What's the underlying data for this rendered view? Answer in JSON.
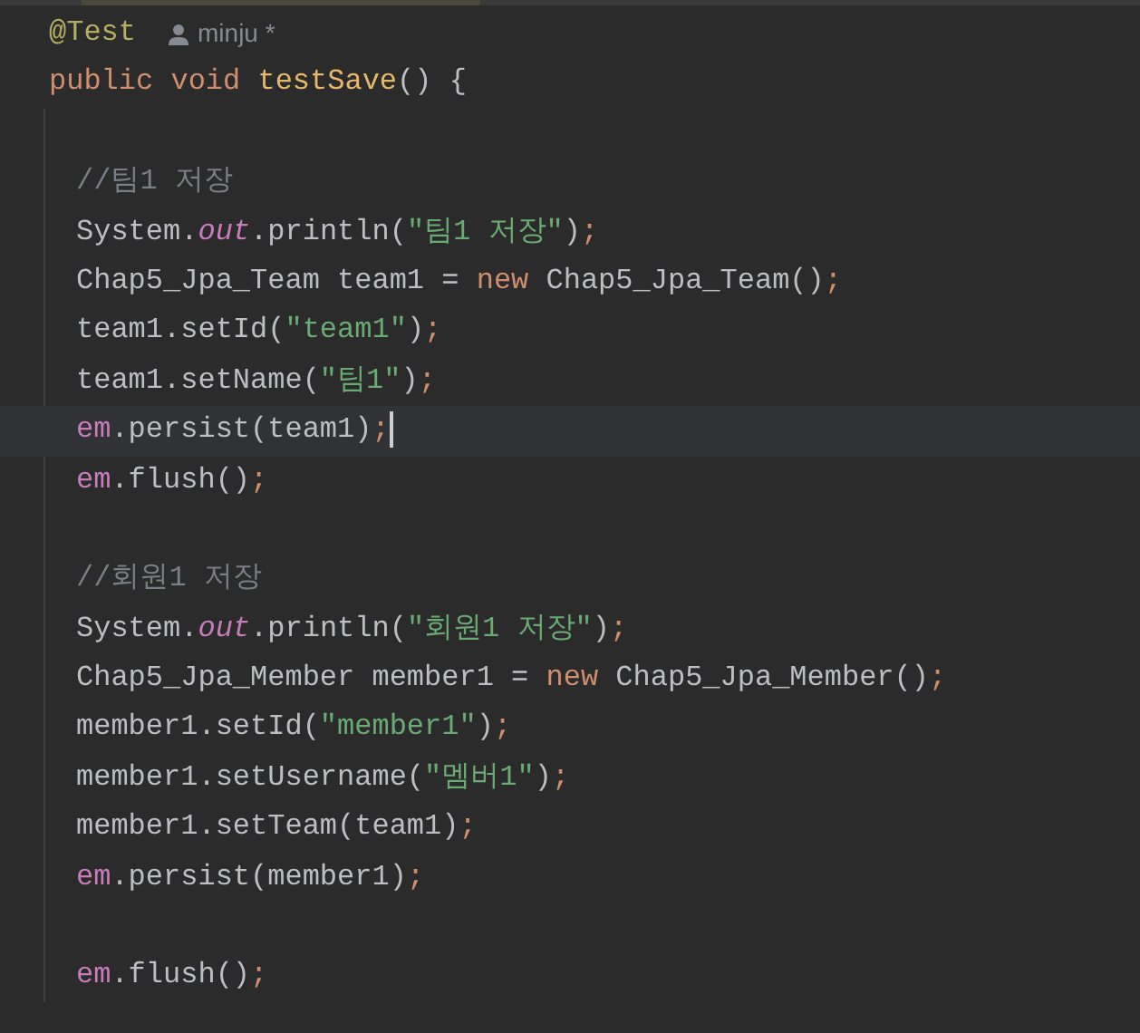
{
  "editor": {
    "annotation": {
      "text": "@Test",
      "author": "minju *"
    },
    "method": {
      "signature": [
        {
          "kind": "kw",
          "text": "public void "
        },
        {
          "kind": "decl",
          "text": "testSave"
        },
        {
          "kind": "plain",
          "text": "() {"
        }
      ],
      "body": [
        {
          "kind": "blank"
        },
        {
          "kind": "code",
          "current": false,
          "tokens": [
            {
              "kind": "cmt",
              "text": "//팀1 저장"
            }
          ]
        },
        {
          "kind": "code",
          "current": false,
          "tokens": [
            {
              "kind": "plain",
              "text": "System."
            },
            {
              "kind": "static",
              "text": "out"
            },
            {
              "kind": "plain",
              "text": ".println("
            },
            {
              "kind": "str",
              "text": "\"팀1 저장\""
            },
            {
              "kind": "plain",
              "text": ")"
            },
            {
              "kind": "kw",
              "text": ";"
            }
          ]
        },
        {
          "kind": "code",
          "current": false,
          "tokens": [
            {
              "kind": "plain",
              "text": "Chap5_Jpa_Team team1 = "
            },
            {
              "kind": "kw",
              "text": "new "
            },
            {
              "kind": "plain",
              "text": "Chap5_Jpa_Team()"
            },
            {
              "kind": "kw",
              "text": ";"
            }
          ]
        },
        {
          "kind": "code",
          "current": false,
          "tokens": [
            {
              "kind": "plain",
              "text": "team1.setId("
            },
            {
              "kind": "str",
              "text": "\"team1\""
            },
            {
              "kind": "plain",
              "text": ")"
            },
            {
              "kind": "kw",
              "text": ";"
            }
          ]
        },
        {
          "kind": "code",
          "current": false,
          "tokens": [
            {
              "kind": "plain",
              "text": "team1.setName("
            },
            {
              "kind": "str",
              "text": "\"팀1\""
            },
            {
              "kind": "plain",
              "text": ")"
            },
            {
              "kind": "kw",
              "text": ";"
            }
          ]
        },
        {
          "kind": "code",
          "current": true,
          "tokens": [
            {
              "kind": "field",
              "text": "em"
            },
            {
              "kind": "plain",
              "text": ".persist(team1)"
            },
            {
              "kind": "kw",
              "text": ";"
            }
          ]
        },
        {
          "kind": "code",
          "current": false,
          "tokens": [
            {
              "kind": "field",
              "text": "em"
            },
            {
              "kind": "plain",
              "text": ".flush()"
            },
            {
              "kind": "kw",
              "text": ";"
            }
          ]
        },
        {
          "kind": "blank"
        },
        {
          "kind": "code",
          "current": false,
          "tokens": [
            {
              "kind": "cmt",
              "text": "//회원1 저장"
            }
          ]
        },
        {
          "kind": "code",
          "current": false,
          "tokens": [
            {
              "kind": "plain",
              "text": "System."
            },
            {
              "kind": "static",
              "text": "out"
            },
            {
              "kind": "plain",
              "text": ".println("
            },
            {
              "kind": "str",
              "text": "\"회원1 저장\""
            },
            {
              "kind": "plain",
              "text": ")"
            },
            {
              "kind": "kw",
              "text": ";"
            }
          ]
        },
        {
          "kind": "code",
          "current": false,
          "tokens": [
            {
              "kind": "plain",
              "text": "Chap5_Jpa_Member member1 = "
            },
            {
              "kind": "kw",
              "text": "new "
            },
            {
              "kind": "plain",
              "text": "Chap5_Jpa_Member()"
            },
            {
              "kind": "kw",
              "text": ";"
            }
          ]
        },
        {
          "kind": "code",
          "current": false,
          "tokens": [
            {
              "kind": "plain",
              "text": "member1.setId("
            },
            {
              "kind": "str",
              "text": "\"member1\""
            },
            {
              "kind": "plain",
              "text": ")"
            },
            {
              "kind": "kw",
              "text": ";"
            }
          ]
        },
        {
          "kind": "code",
          "current": false,
          "tokens": [
            {
              "kind": "plain",
              "text": "member1.setUsername("
            },
            {
              "kind": "str",
              "text": "\"멤버1\""
            },
            {
              "kind": "plain",
              "text": ")"
            },
            {
              "kind": "kw",
              "text": ";"
            }
          ]
        },
        {
          "kind": "code",
          "current": false,
          "tokens": [
            {
              "kind": "plain",
              "text": "member1.setTeam(team1)"
            },
            {
              "kind": "kw",
              "text": ";"
            }
          ]
        },
        {
          "kind": "code",
          "current": false,
          "tokens": [
            {
              "kind": "field",
              "text": "em"
            },
            {
              "kind": "plain",
              "text": ".persist(member1)"
            },
            {
              "kind": "kw",
              "text": ";"
            }
          ]
        },
        {
          "kind": "blank"
        },
        {
          "kind": "code",
          "current": false,
          "tokens": [
            {
              "kind": "field",
              "text": "em"
            },
            {
              "kind": "plain",
              "text": ".flush()"
            },
            {
              "kind": "kw",
              "text": ";"
            }
          ]
        }
      ]
    }
  }
}
